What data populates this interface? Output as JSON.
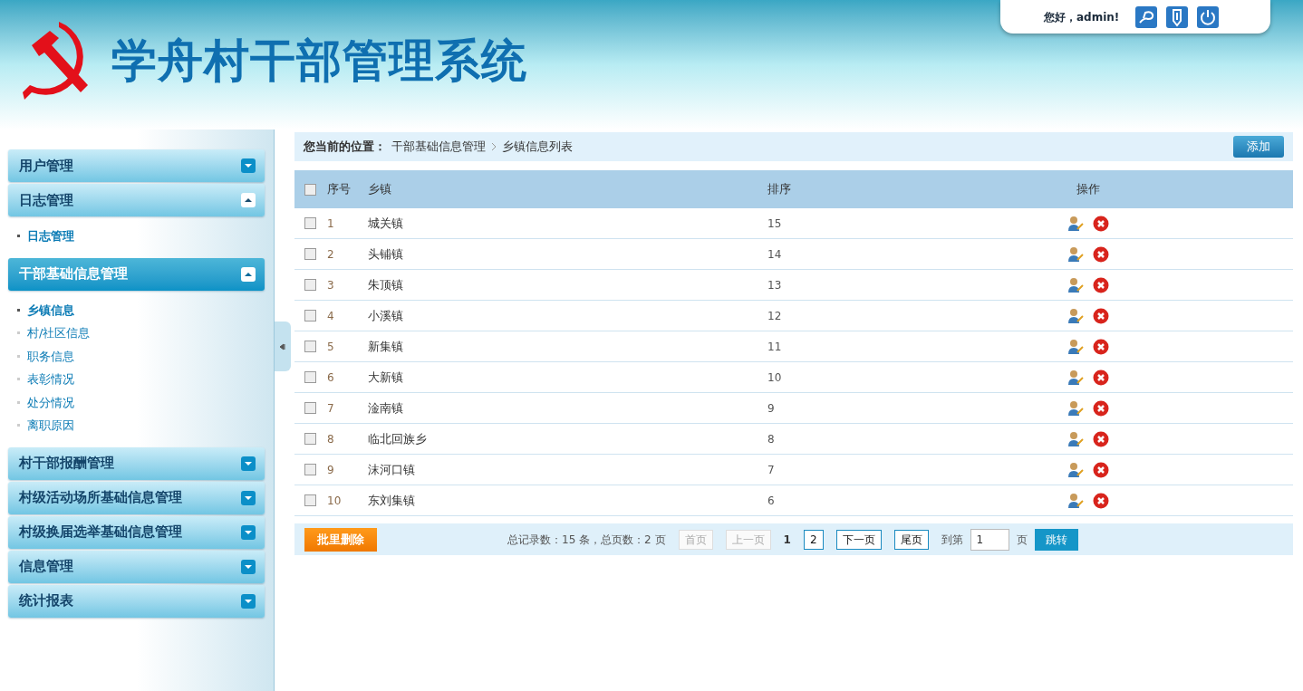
{
  "header": {
    "title": "学舟村干部管理系统",
    "greeting": "您好，admin!"
  },
  "sidebar": {
    "groups": [
      {
        "label": "用户管理",
        "expanded": false,
        "selected": false
      },
      {
        "label": "日志管理",
        "expanded": true,
        "selected": false,
        "items": [
          {
            "label": "日志管理",
            "selected": true
          }
        ]
      },
      {
        "label": "干部基础信息管理",
        "expanded": true,
        "selected": true,
        "items": [
          {
            "label": "乡镇信息",
            "selected": true
          },
          {
            "label": "村/社区信息",
            "selected": false
          },
          {
            "label": "职务信息",
            "selected": false
          },
          {
            "label": "表彰情况",
            "selected": false
          },
          {
            "label": "处分情况",
            "selected": false
          },
          {
            "label": "离职原因",
            "selected": false
          }
        ]
      },
      {
        "label": "村干部报酬管理",
        "expanded": false,
        "selected": false
      },
      {
        "label": "村级活动场所基础信息管理",
        "expanded": false,
        "selected": false
      },
      {
        "label": "村级换届选举基础信息管理",
        "expanded": false,
        "selected": false
      },
      {
        "label": "信息管理",
        "expanded": false,
        "selected": false
      },
      {
        "label": "统计报表",
        "expanded": false,
        "selected": false
      }
    ]
  },
  "breadcrumb": {
    "label": "您当前的位置：",
    "path": [
      "干部基础信息管理",
      "乡镇信息列表"
    ],
    "add_button": "添加"
  },
  "table": {
    "select_all_checked": false,
    "columns": [
      "序号",
      "乡镇",
      "排序",
      "操作"
    ],
    "rows": [
      {
        "checked": false,
        "cells": [
          "1",
          "城关镇",
          "15"
        ]
      },
      {
        "checked": false,
        "cells": [
          "2",
          "头铺镇",
          "14"
        ]
      },
      {
        "checked": false,
        "cells": [
          "3",
          "朱顶镇",
          "13"
        ]
      },
      {
        "checked": false,
        "cells": [
          "4",
          "小溪镇",
          "12"
        ]
      },
      {
        "checked": false,
        "cells": [
          "5",
          "新集镇",
          "11"
        ]
      },
      {
        "checked": false,
        "cells": [
          "6",
          "大新镇",
          "10"
        ]
      },
      {
        "checked": false,
        "cells": [
          "7",
          "淦南镇",
          "9"
        ]
      },
      {
        "checked": false,
        "cells": [
          "8",
          "临北回族乡",
          "8"
        ]
      },
      {
        "checked": false,
        "cells": [
          "9",
          "沫河口镇",
          "7"
        ]
      },
      {
        "checked": false,
        "cells": [
          "10",
          "东刘集镇",
          "6"
        ]
      }
    ]
  },
  "footer": {
    "batch_delete": "批里删除",
    "summary": "总记录数：15 条，总页数：2 页",
    "pages": [
      {
        "kind": "link",
        "label": "首页",
        "disabled": true
      },
      {
        "kind": "link",
        "label": "上一页",
        "disabled": true
      },
      {
        "kind": "current",
        "label": "1"
      },
      {
        "kind": "link",
        "label": "2",
        "disabled": false
      },
      {
        "kind": "link",
        "label": "下一页",
        "disabled": false
      },
      {
        "kind": "link",
        "label": "尾页",
        "disabled": false
      }
    ],
    "goto_label": "到第",
    "goto_value": "1",
    "goto_unit": "页",
    "goto_button": "跳转"
  }
}
